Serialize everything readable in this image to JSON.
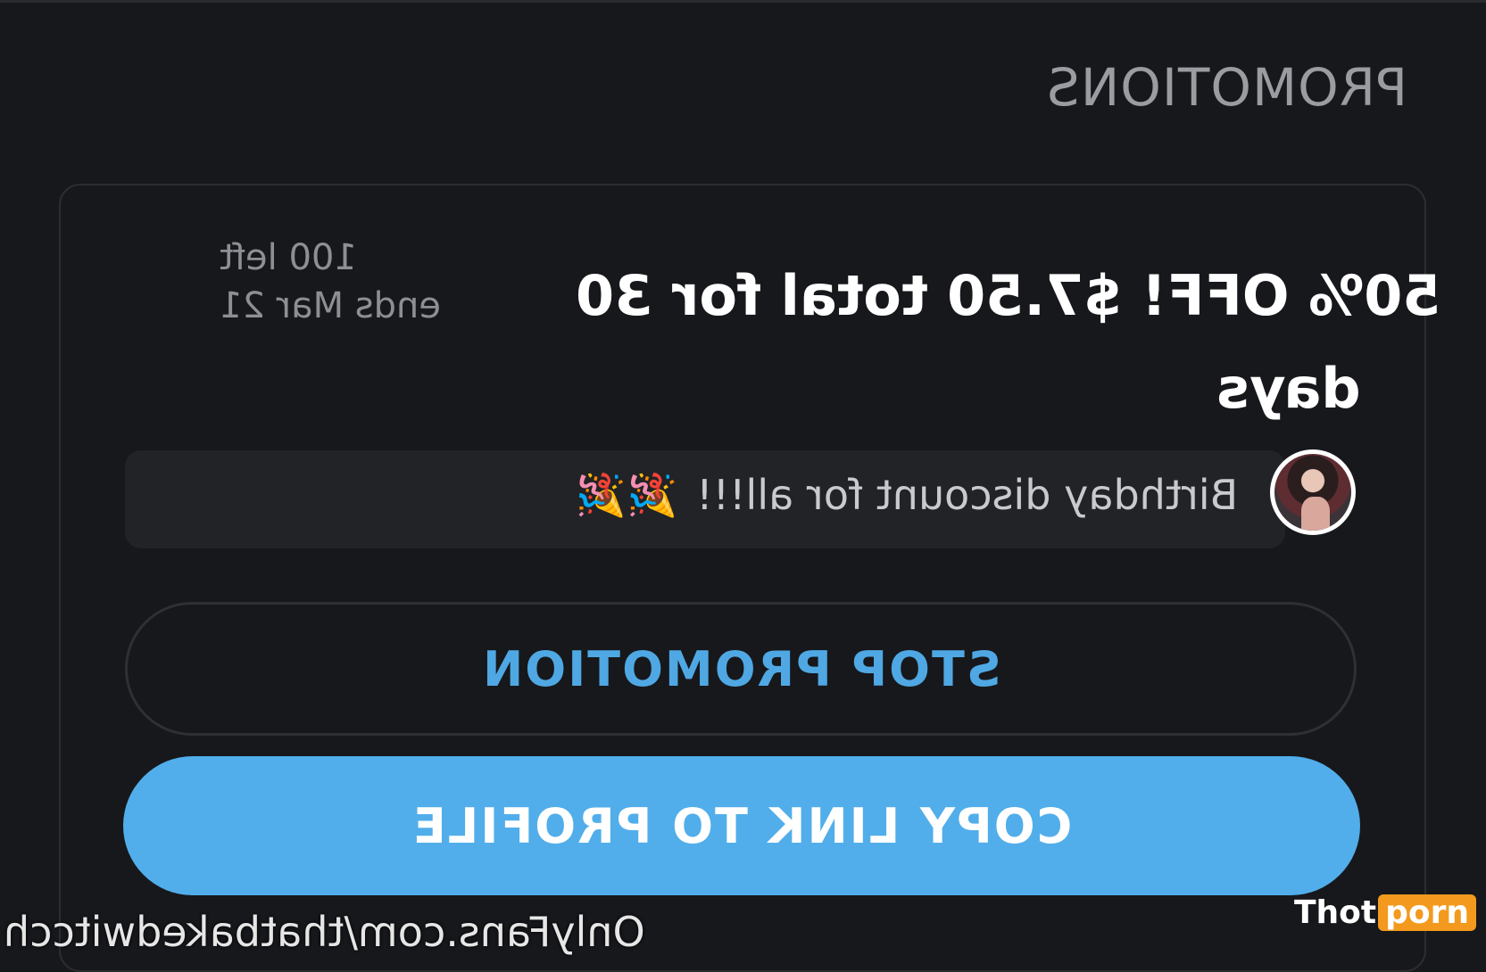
{
  "section": {
    "title": "PROMOTIONS"
  },
  "promotion": {
    "headline_line1": "50% OFF! $7.50 total for 30",
    "headline_line2": "days",
    "remaining": "100 left",
    "ends": "ends Mar 21",
    "message": "Birthday discount for all!!!",
    "message_emoji": "🎉🎉"
  },
  "buttons": {
    "stop": "STOP PROMOTION",
    "copy": "COPY LINK TO PROFILE"
  },
  "watermark": {
    "url": "OnlyFans.com/thatbakedwitcch",
    "logo_part1": "Thot",
    "logo_part2": "porn"
  },
  "colors": {
    "background": "#17181c",
    "accent": "#51aeea",
    "accent_text": "#4fa8e3"
  },
  "icons": {
    "avatar": "avatar-photo",
    "emoji": "party-popper"
  }
}
